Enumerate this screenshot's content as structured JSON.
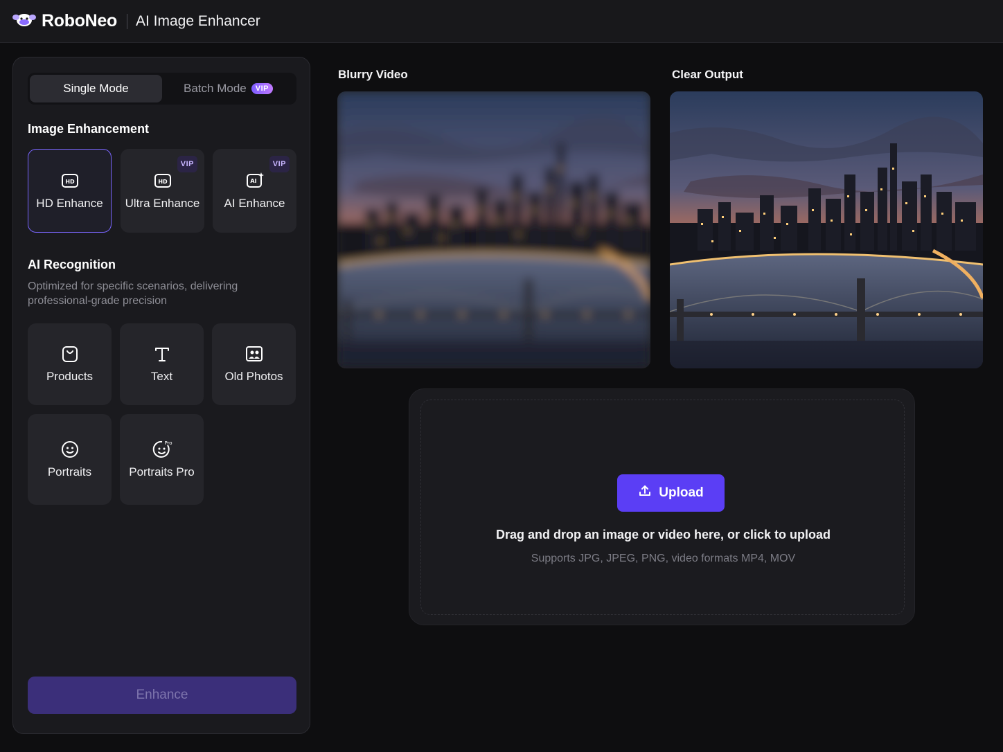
{
  "header": {
    "brand": "RoboNeo",
    "app_title": "AI Image Enhancer",
    "logo_icon": "roboneo-logo-icon"
  },
  "sidebar": {
    "modes": [
      {
        "label": "Single Mode",
        "active": true
      },
      {
        "label": "Batch Mode",
        "badge": "VIP",
        "active": false
      }
    ],
    "image_enhancement": {
      "title": "Image Enhancement",
      "options": [
        {
          "label": "HD Enhance",
          "icon": "hd-icon",
          "selected": true
        },
        {
          "label": "Ultra Enhance",
          "icon": "hd-icon",
          "badge": "VIP"
        },
        {
          "label": "AI Enhance",
          "icon": "ai-sparkle-icon",
          "badge": "VIP"
        }
      ]
    },
    "ai_recognition": {
      "title": "AI Recognition",
      "description": "Optimized for specific scenarios, delivering professional-grade precision",
      "options": [
        {
          "label": "Products",
          "icon": "shopping-bag-icon"
        },
        {
          "label": "Text",
          "icon": "text-icon"
        },
        {
          "label": "Old Photos",
          "icon": "old-photo-icon"
        },
        {
          "label": "Portraits",
          "icon": "smiley-face-icon"
        },
        {
          "label": "Portraits Pro",
          "icon": "smiley-pro-icon",
          "icon_text": "Pro"
        }
      ]
    },
    "enhance_label": "Enhance"
  },
  "preview": {
    "before_label": "Blurry Video",
    "after_label": "Clear Output"
  },
  "upload": {
    "button_label": "Upload",
    "main_text": "Drag and drop an image or video here, or click to upload",
    "sub_text": "Supports JPG, JPEG, PNG, video formats MP4, MOV"
  },
  "colors": {
    "accent": "#5b3ef5",
    "selected_border": "#7a66ff",
    "panel": "#1a1a1e",
    "background": "#0e0e10"
  }
}
